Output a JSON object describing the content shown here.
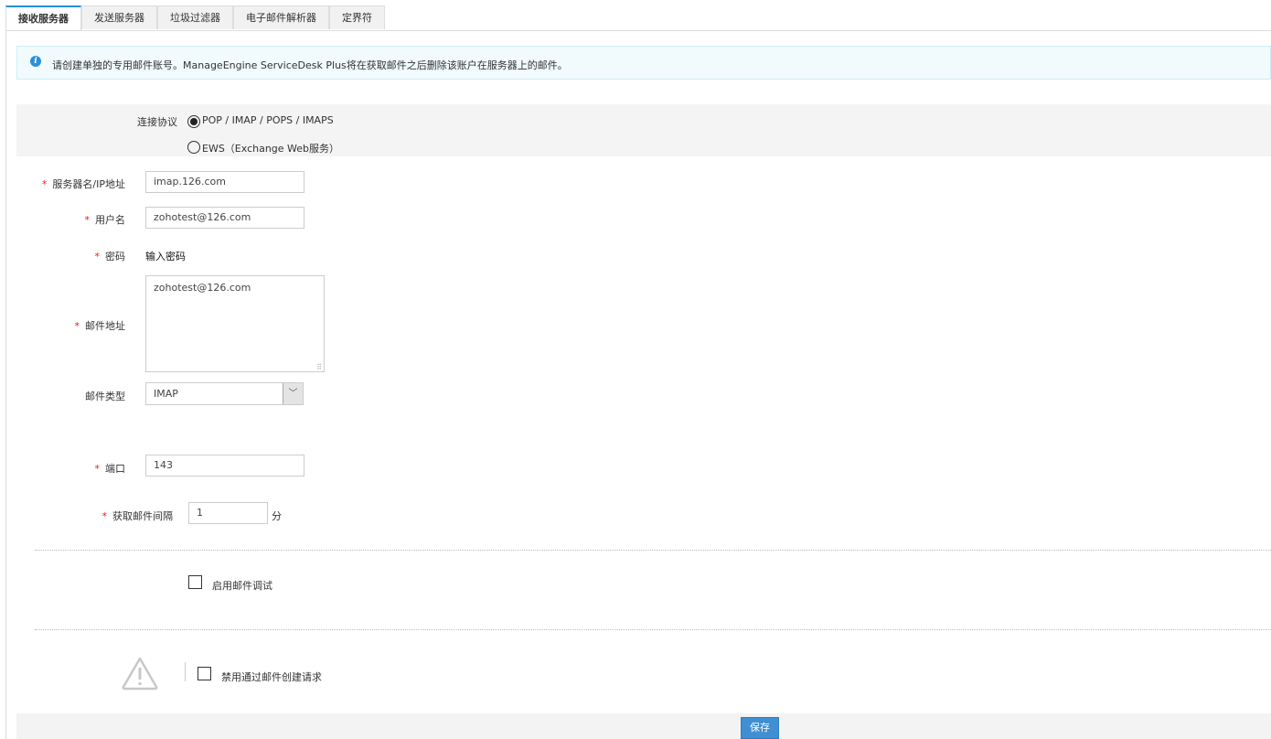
{
  "tabs": [
    {
      "label": "接收服务器"
    },
    {
      "label": "发送服务器"
    },
    {
      "label": "垃圾过滤器"
    },
    {
      "label": "电子邮件解析器"
    },
    {
      "label": "定界符"
    }
  ],
  "info": {
    "icon": "info-icon",
    "text": "请创建单独的专用邮件账号。ManageEngine ServiceDesk Plus将在获取邮件之后删除该账户在服务器上的邮件。"
  },
  "form": {
    "protocol_label": "连接协议",
    "protocol_options": [
      {
        "label": "POP / IMAP / POPS / IMAPS",
        "selected": true
      },
      {
        "label": "EWS（Exchange Web服务）",
        "selected": false
      }
    ],
    "required_mark": "*",
    "server_label": "服务器名/IP地址",
    "server_value": "imap.126.com",
    "username_label": "用户名",
    "username_value": "zohotest@126.com",
    "password_label": "密码",
    "password_link": "输入密码",
    "email_label": "邮件地址",
    "email_value": "zohotest@126.com",
    "mail_type_label": "邮件类型",
    "mail_type_value": "IMAP",
    "port_label": "端口",
    "port_value": "143",
    "interval_label": "获取邮件间隔",
    "interval_value": "1",
    "interval_unit": "分",
    "debug_label": "启用邮件调试",
    "disable_label": "禁用通过邮件创建请求"
  },
  "footer": {
    "save_label": "保存"
  },
  "colors": {
    "accent": "#3f8fd2",
    "required": "#e02020"
  }
}
